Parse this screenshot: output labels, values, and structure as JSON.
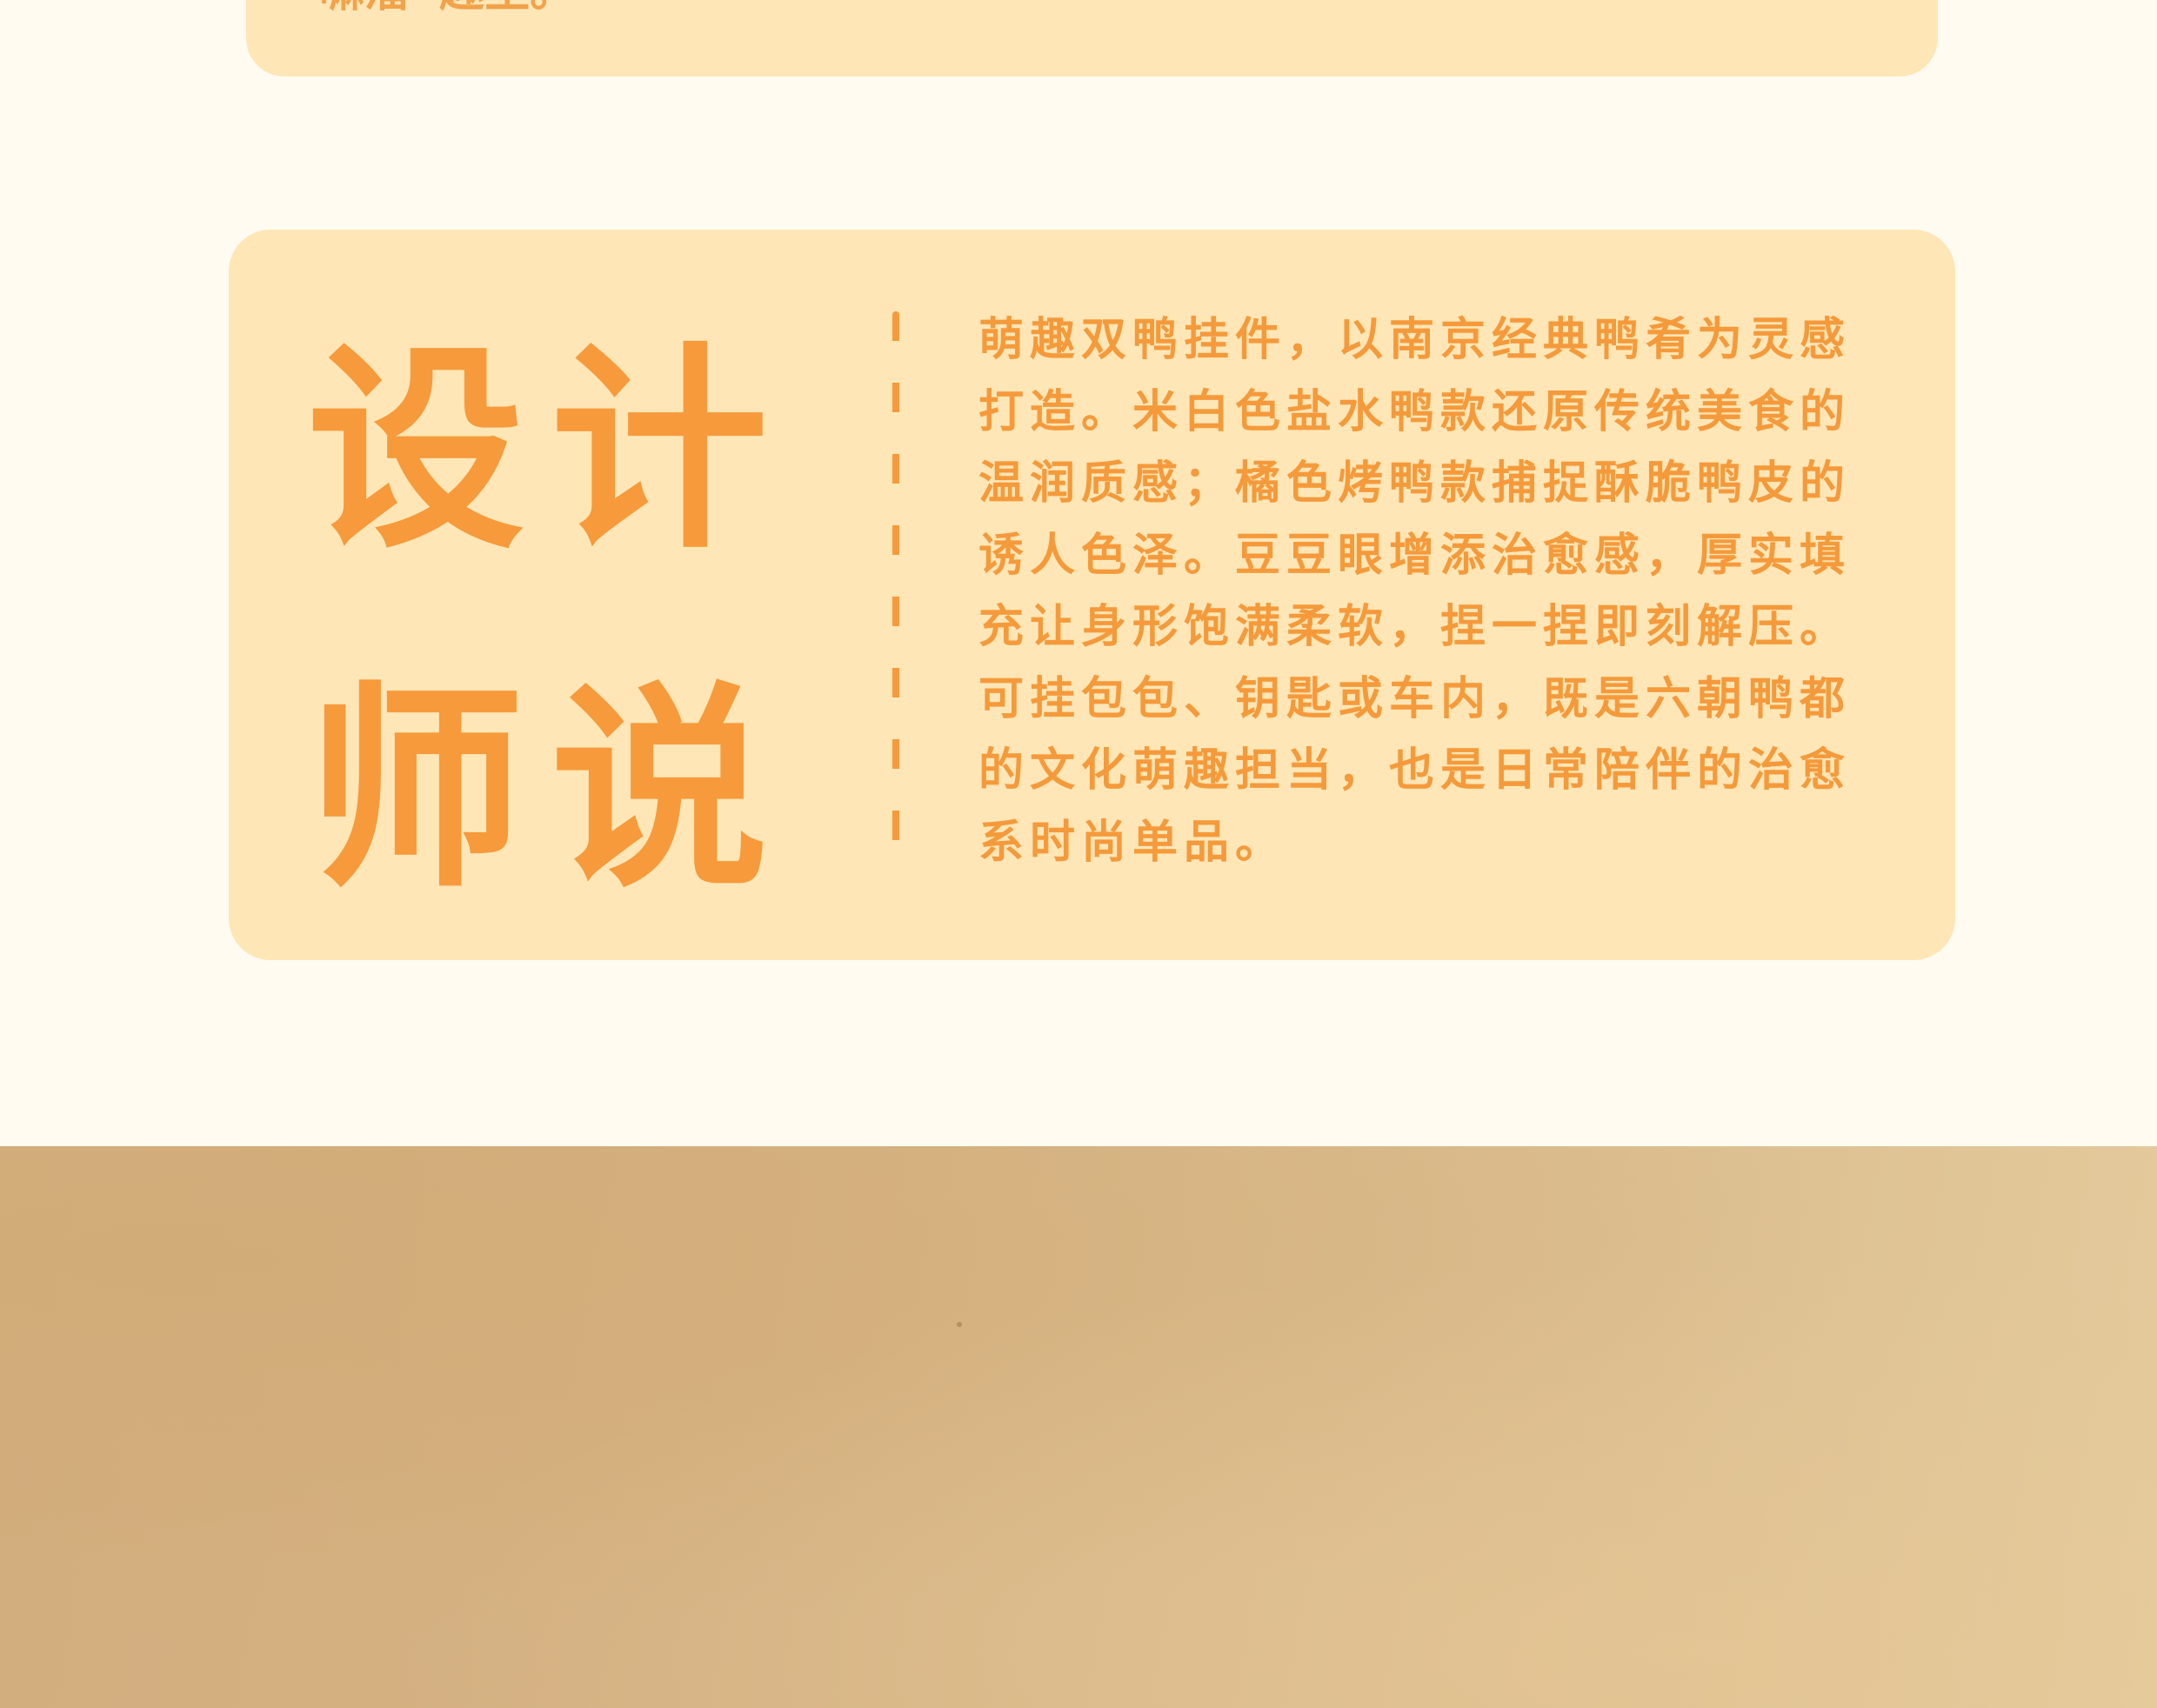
{
  "top_card": {
    "partial_text": "嘛溜”趣生。"
  },
  "designer_card": {
    "headline_line_1": "设计",
    "headline_line_2": "师说",
    "description": "萌趣双鸭挂件，以南京经典鸭肴为灵感打造。米白色盐水鸭款还原传统美食的温润质感；橘色烤鸭款捕捉酥脆鸭皮的诱人色泽。豆豆眼增添治愈感，厚实填充让身形饱满柔软，捏一捏即刻解压。可挂包包、钥匙或车内，既是六朝鸭都的文化萌趣担当，也是日常陪伴的治愈系时尚单品。"
  },
  "colors": {
    "page_background": "#fffbf1",
    "card_background": "#ffe6b6",
    "accent_orange": "#f79a3b",
    "photo_tone": "#d5b283"
  }
}
